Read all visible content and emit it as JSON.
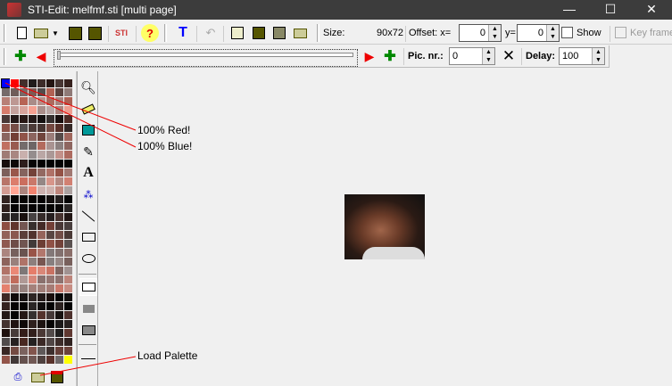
{
  "window": {
    "title": "STI-Edit: melfmf.sti [multi page]",
    "minimize": "—",
    "maximize": "☐",
    "close": "✕"
  },
  "toolbar": {
    "size_label": "Size:",
    "size_value": "90x72",
    "offset_label": "Offset: x=",
    "offset_x": "0",
    "y_label": "y=",
    "offset_y": "0",
    "show_label": "Show",
    "keyframe_label": "Key frame",
    "help": "?"
  },
  "toolbar2": {
    "pic_nr_label": "Pic. nr.:",
    "pic_nr": "0",
    "delay_label": "Delay:",
    "delay": "100",
    "clear": "✕"
  },
  "tools": {
    "text_tool": "A"
  },
  "annotations": {
    "red": "100% Red!",
    "blue": "100% Blue!",
    "load": "Load Palette"
  },
  "palette": {
    "selected_fg": "#0000ff",
    "selected_bg": "#ff0000",
    "last": "#ffff00"
  }
}
